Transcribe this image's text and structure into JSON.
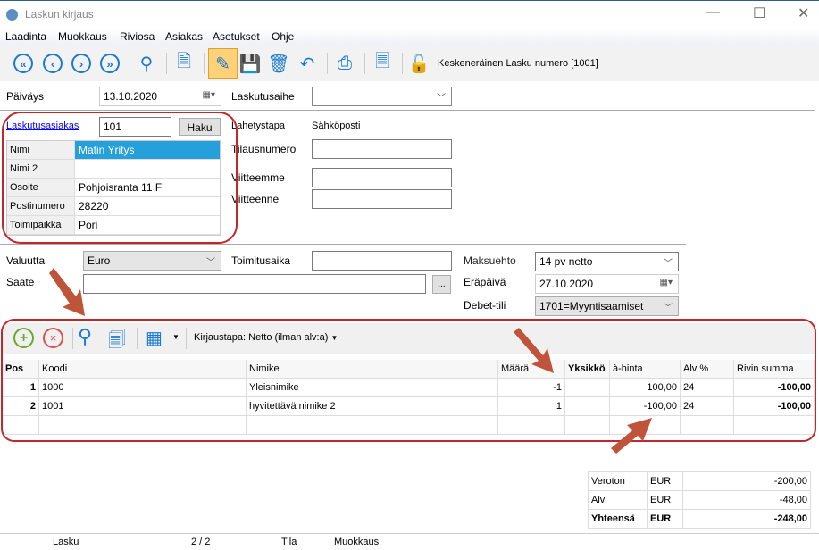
{
  "window": {
    "title": "Laskun kirjaus",
    "minimize": "—",
    "maximize": "☐",
    "close": "✕"
  },
  "menu": [
    "Laadinta",
    "Muokkaus",
    "Riviosa",
    "Asiakas",
    "Asetukset",
    "Ohje"
  ],
  "toolbar": {
    "status_text": "Keskeneräinen Lasku numero [1001]",
    "icons": [
      "first-icon",
      "previous-icon",
      "next-icon",
      "last-icon",
      "search-icon",
      "new-document-icon",
      "edit-icon",
      "save-icon",
      "delete-icon",
      "undo-icon",
      "print-icon",
      "document-info-icon",
      "unlock-icon"
    ]
  },
  "header": {
    "paivays_label": "Päiväys",
    "paivays_value": "13.10.2020",
    "laskutusaihe_label": "Laskutusaihe",
    "laskutusaihe_value": "",
    "asiakas_link": "Laskutusasiakas",
    "asiakas_value": "101",
    "haku_button": "Haku",
    "customer": [
      {
        "k": "Nimi",
        "v": "Matin Yritys"
      },
      {
        "k": "Nimi 2",
        "v": ""
      },
      {
        "k": "Osoite",
        "v": "Pohjoisranta 11 F"
      },
      {
        "k": "Postinumero",
        "v": "28220"
      },
      {
        "k": "Toimipaikka",
        "v": "Pori"
      }
    ],
    "lahetystapa_label": "Lahetystapa",
    "lahetystapa_value": "Sähköposti",
    "tilausnumero_label": "Tilausnumero",
    "viitteemme_label": "Viitteemme",
    "viitteenne_label": "Viitteenne",
    "valuutta_label": "Valuutta",
    "valuutta_value": "Euro",
    "toimitusaika_label": "Toimitusaika",
    "saate_label": "Saate",
    "saate_button": "...",
    "maksuehto_label": "Maksuehto",
    "maksuehto_value": "14 pv netto",
    "erapaiva_label": "Eräpäivä",
    "erapaiva_value": "27.10.2020",
    "debet_label": "Debet-tili",
    "debet_value": "1701=Myyntisaamiset"
  },
  "rows_toolbar": {
    "kirjaustapa": "Kirjaustapa: Netto (ilman alv:a)"
  },
  "grid": {
    "columns": [
      "Pos",
      "Koodi",
      "Nimike",
      "Määrä",
      "Yksikkö",
      "à-hinta",
      "Alv %",
      "Rivin summa"
    ],
    "rows": [
      [
        "1",
        "1000",
        "Yleisnimike",
        "-1",
        "",
        "100,00",
        "24",
        "-100,00"
      ],
      [
        "2",
        "1001",
        "hyvitettävä nimike 2",
        "1",
        "",
        "-100,00",
        "24",
        "-100,00"
      ]
    ]
  },
  "totals": [
    {
      "label": "Veroton",
      "cur": "EUR",
      "value": "-200,00"
    },
    {
      "label": "Alv",
      "cur": "EUR",
      "value": "-48,00"
    },
    {
      "label": "Yhteensä",
      "cur": "EUR",
      "value": "-248,00"
    }
  ],
  "statusbar": {
    "type": "Lasku",
    "page": "2 / 2",
    "tila_label": "Tila",
    "tila_value": "Muokkaus"
  },
  "colors": {
    "accent": "#1a7ad0",
    "selection": "#26a0da",
    "annotation": "#c0282c"
  }
}
